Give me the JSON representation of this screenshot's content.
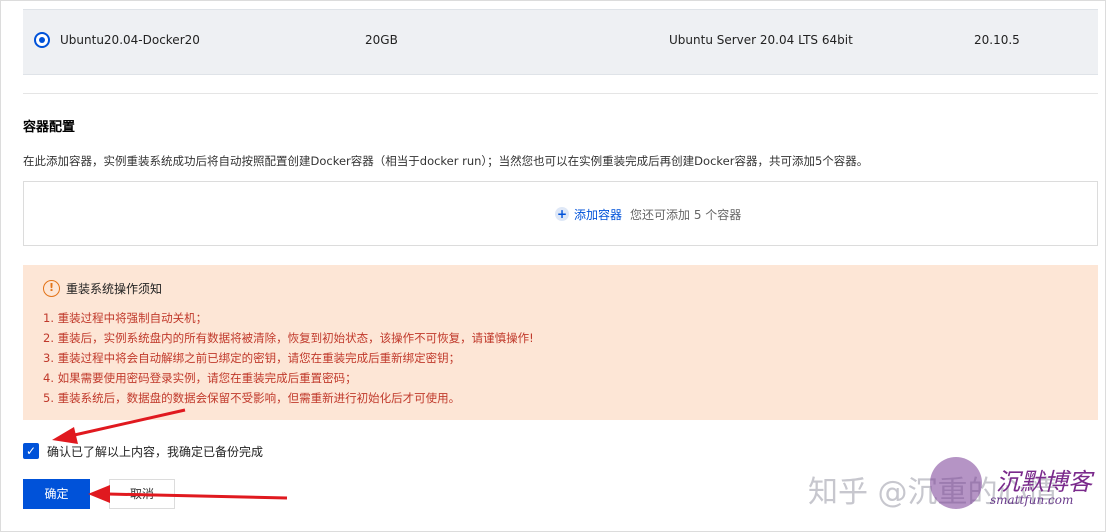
{
  "image_row": {
    "name": "Ubuntu20.04-Docker20",
    "size": "20GB",
    "os": "Ubuntu Server 20.04 LTS 64bit",
    "docker_version": "20.10.5"
  },
  "container_config": {
    "title": "容器配置",
    "description": "在此添加容器，实例重装系统成功后将自动按照配置创建Docker容器（相当于docker run）；当然您也可以在实例重装完成后再创建Docker容器，共可添加5个容器。",
    "add_label": "添加容器",
    "add_hint": "您还可添加 5 个容器"
  },
  "notice": {
    "title": "重装系统操作须知",
    "items": [
      "1. 重装过程中将强制自动关机；",
      "2. 重装后，实例系统盘内的所有数据将被清除，恢复到初始状态，该操作不可恢复，请谨慎操作!",
      "3. 重装过程中将会自动解绑之前已绑定的密钥，请您在重装完成后重新绑定密钥；",
      "4. 如果需要使用密码登录实例，请您在重装完成后重置密码；",
      "5. 重装系统后，数据盘的数据会保留不受影响，但需重新进行初始化后才可使用。"
    ]
  },
  "confirm": {
    "label": "确认已了解以上内容，我确定已备份完成",
    "checked": true
  },
  "buttons": {
    "ok": "确定",
    "cancel": "取消"
  },
  "watermark": {
    "text": "知乎 @沉重的心情",
    "script": "沉默博客",
    "site": "smattfun.com"
  },
  "colors": {
    "primary": "#0052d9",
    "notice_bg": "#fde6d6",
    "notice_text": "#c0392b",
    "annotation_arrow": "#e0191f"
  }
}
